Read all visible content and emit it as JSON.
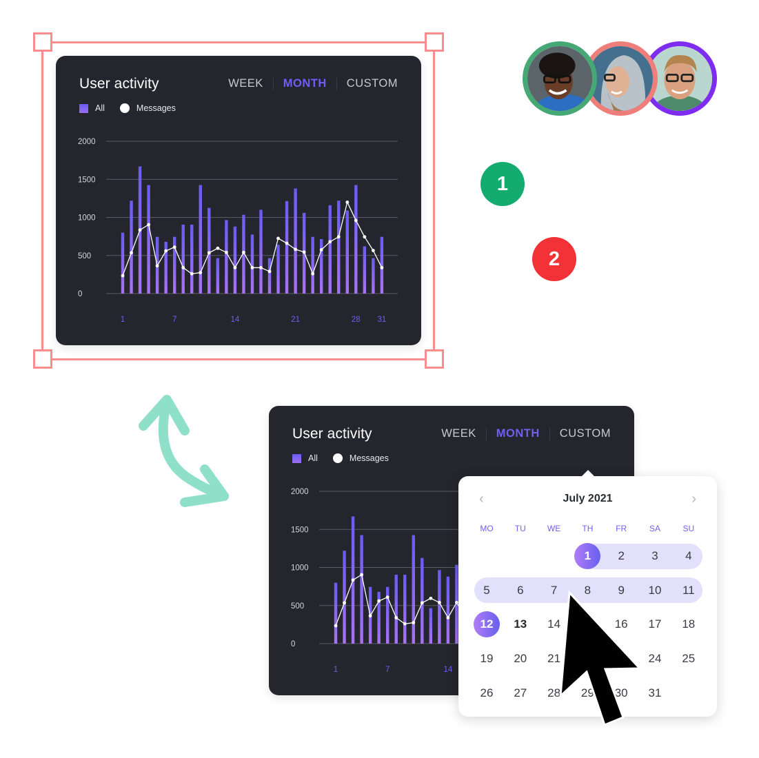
{
  "widget": {
    "title": "User activity",
    "tabs": [
      {
        "label": "WEEK",
        "active": false
      },
      {
        "label": "MONTH",
        "active": true
      },
      {
        "label": "CUSTOM",
        "active": false
      }
    ],
    "legend": [
      {
        "label": "All",
        "shape": "square"
      },
      {
        "label": "Messages",
        "shape": "circle"
      }
    ]
  },
  "colors": {
    "card_bg": "#24252d",
    "accent": "#6f5ff2",
    "bar_top": "#6a5cf2",
    "bar_bottom": "#a773f2",
    "line": "#ffffff",
    "selection": "#f78d8d",
    "arrow": "#8fe0c9",
    "badge_1": "#14ab6e",
    "badge_2": "#f23237",
    "avatar_borders": [
      "#45a875",
      "#ef7d7a",
      "#7e2df0"
    ],
    "range_bg": "#e3e0fb"
  },
  "chart_data": {
    "type": "bar",
    "title": "User activity",
    "xlabel": "",
    "ylabel": "",
    "ylim": [
      0,
      2000
    ],
    "yticks": [
      0,
      500,
      1000,
      1500,
      2000
    ],
    "x": [
      1,
      2,
      3,
      4,
      5,
      6,
      7,
      8,
      9,
      10,
      11,
      12,
      13,
      14,
      15,
      16,
      17,
      18,
      19,
      20,
      21,
      22,
      23,
      24,
      25,
      26,
      27,
      28,
      29,
      30,
      31
    ],
    "xtick_labels": [
      "1",
      "7",
      "14",
      "21",
      "28",
      "31"
    ],
    "xtick_values": [
      1,
      7,
      14,
      21,
      28,
      31
    ],
    "grid": true,
    "series": [
      {
        "name": "All",
        "type": "bar",
        "values": [
          800,
          1220,
          1670,
          1425,
          745,
          680,
          745,
          905,
          905,
          1425,
          1125,
          465,
          965,
          880,
          1035,
          775,
          1100,
          465,
          640,
          1215,
          1380,
          1060,
          745,
          715,
          1160,
          1220,
          1090,
          1425,
          620,
          465,
          745
        ]
      },
      {
        "name": "Messages",
        "type": "line",
        "values": [
          235,
          535,
          835,
          905,
          365,
          560,
          610,
          340,
          260,
          275,
          535,
          595,
          540,
          340,
          540,
          340,
          340,
          290,
          725,
          660,
          580,
          545,
          260,
          575,
          680,
          745,
          1200,
          960,
          745,
          565,
          340
        ]
      }
    ]
  },
  "avatars": [
    {
      "name": "avatar-1"
    },
    {
      "name": "avatar-2"
    },
    {
      "name": "avatar-3"
    }
  ],
  "badges": [
    {
      "label": "1"
    },
    {
      "label": "2"
    }
  ],
  "calendar": {
    "month_label": "July 2021",
    "prev_icon": "‹",
    "next_icon": "›",
    "weekdays": [
      "MO",
      "TU",
      "WE",
      "TH",
      "FR",
      "SA",
      "SU"
    ],
    "first_weekday_index": 3,
    "days_in_month": 31,
    "selected_days": [
      1,
      12
    ],
    "highlighted_range": [
      1,
      11
    ],
    "today": 13
  }
}
